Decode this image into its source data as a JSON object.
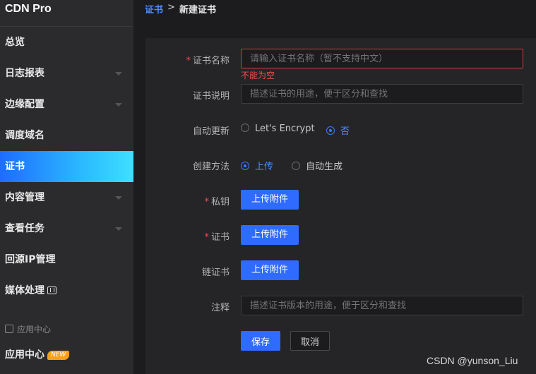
{
  "app": {
    "title": "CDN Pro"
  },
  "sidebar": {
    "items": [
      {
        "label": "总览",
        "has_chevron": false
      },
      {
        "label": "日志报表",
        "has_chevron": true
      },
      {
        "label": "边缘配置",
        "has_chevron": true
      },
      {
        "label": "调度域名",
        "has_chevron": false
      },
      {
        "label": "证书",
        "has_chevron": false,
        "active": true
      },
      {
        "label": "内容管理",
        "has_chevron": true
      },
      {
        "label": "查看任务",
        "has_chevron": true
      },
      {
        "label": "回源IP管理",
        "has_chevron": false
      },
      {
        "label": "媒体处理",
        "has_chevron": false,
        "icon": "film-icon"
      }
    ],
    "section_label": "应用中心",
    "app_center": {
      "label": "应用中心",
      "badge": "NEW"
    }
  },
  "breadcrumb": {
    "parent": "证书",
    "separator": ">",
    "current": "新建证书"
  },
  "form": {
    "name": {
      "label": "证书名称",
      "required": true,
      "placeholder": "请输入证书名称（暂不支持中文）",
      "error": "不能为空"
    },
    "description": {
      "label": "证书说明",
      "placeholder": "描述证书的用途，便于区分和查找"
    },
    "auto_renew": {
      "label": "自动更新",
      "options": [
        "Let's Encrypt",
        "否"
      ],
      "selected": "否"
    },
    "method": {
      "label": "创建方法",
      "options": [
        "上传",
        "自动生成"
      ],
      "selected": "上传"
    },
    "private_key": {
      "label": "私钥",
      "required": true,
      "button": "上传附件"
    },
    "certificate": {
      "label": "证书",
      "required": true,
      "button": "上传附件"
    },
    "chain": {
      "label": "链证书",
      "button": "上传附件"
    },
    "notes": {
      "label": "注释",
      "placeholder": "描述证书版本的用途，便于区分和查找"
    },
    "save": "保存",
    "cancel": "取消"
  },
  "watermark": "CSDN @yunson_Liu",
  "colors": {
    "accent": "#2f6bff",
    "error": "#f04b4b",
    "sidebar_active_start": "#1e6cff",
    "sidebar_active_end": "#3ee0ff"
  }
}
